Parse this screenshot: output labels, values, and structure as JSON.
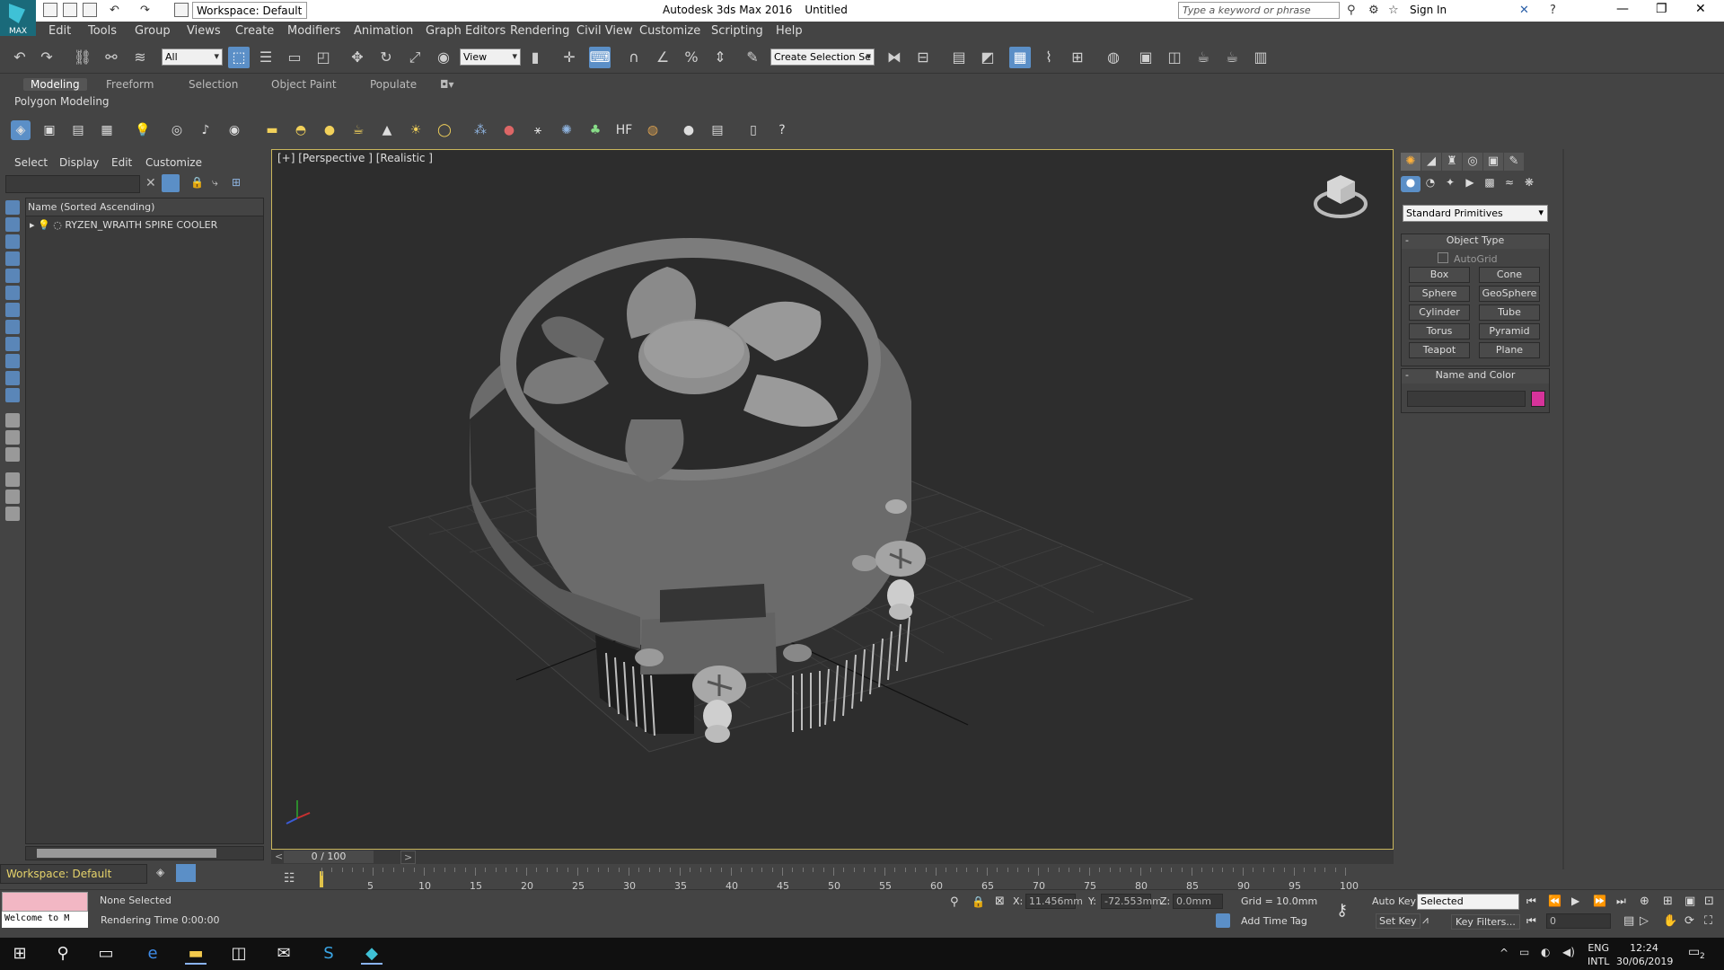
{
  "titlebar": {
    "workspace": "Workspace: Default",
    "app": "Autodesk 3ds Max 2016",
    "doc": "Untitled",
    "search_placeholder": "Type a keyword or phrase",
    "signin": "Sign In",
    "logo_text": "MAX"
  },
  "menu": [
    "Edit",
    "Tools",
    "Group",
    "Views",
    "Create",
    "Modifiers",
    "Animation",
    "Graph Editors",
    "Rendering",
    "Civil View",
    "Customize",
    "Scripting",
    "Help"
  ],
  "toolbar": {
    "filter_all": "All",
    "ref_coord": "View",
    "selection_set": "Create Selection Se"
  },
  "ribbon": {
    "tabs": [
      "Modeling",
      "Freeform",
      "Selection",
      "Object Paint",
      "Populate"
    ],
    "sub": "Polygon Modeling"
  },
  "scene_explorer": {
    "menu": [
      "Select",
      "Display",
      "Edit",
      "Customize"
    ],
    "column_header": "Name (Sorted Ascending)",
    "object": "RYZEN_WRAITH SPIRE COOLER",
    "workspace": "Workspace: Default"
  },
  "viewport": {
    "label": "[+] [Perspective ] [Realistic ]"
  },
  "command_panel": {
    "dropdown": "Standard Primitives",
    "object_type_title": "Object Type",
    "autogrid": "AutoGrid",
    "buttons": [
      "Box",
      "Cone",
      "Sphere",
      "GeoSphere",
      "Cylinder",
      "Tube",
      "Torus",
      "Pyramid",
      "Teapot",
      "Plane"
    ],
    "name_color_title": "Name and Color",
    "color": "#d6339a"
  },
  "timeline": {
    "frame": "0 / 100",
    "ticks": [
      "5",
      "10",
      "15",
      "20",
      "25",
      "30",
      "35",
      "40",
      "45",
      "50",
      "55",
      "60",
      "65",
      "70",
      "75",
      "80",
      "85",
      "90",
      "95",
      "100"
    ]
  },
  "status": {
    "maxscript": "Welcome to M",
    "selected": "None Selected",
    "render_time": "Rendering Time  0:00:00",
    "x_label": "X:",
    "x": "11.456mm",
    "y_label": "Y:",
    "y": "-72.553mm",
    "z_label": "Z:",
    "z": "0.0mm",
    "grid": "Grid = 10.0mm",
    "add_time_tag": "Add Time Tag",
    "auto_key": "Auto Key",
    "set_key": "Set Key",
    "selected_dd": "Selected",
    "key_filters": "Key Filters...",
    "frame_field": "0"
  },
  "taskbar": {
    "lang1": "ENG",
    "lang2": "INTL",
    "time": "12:24",
    "date": "30/06/2019",
    "notifications": "2"
  }
}
